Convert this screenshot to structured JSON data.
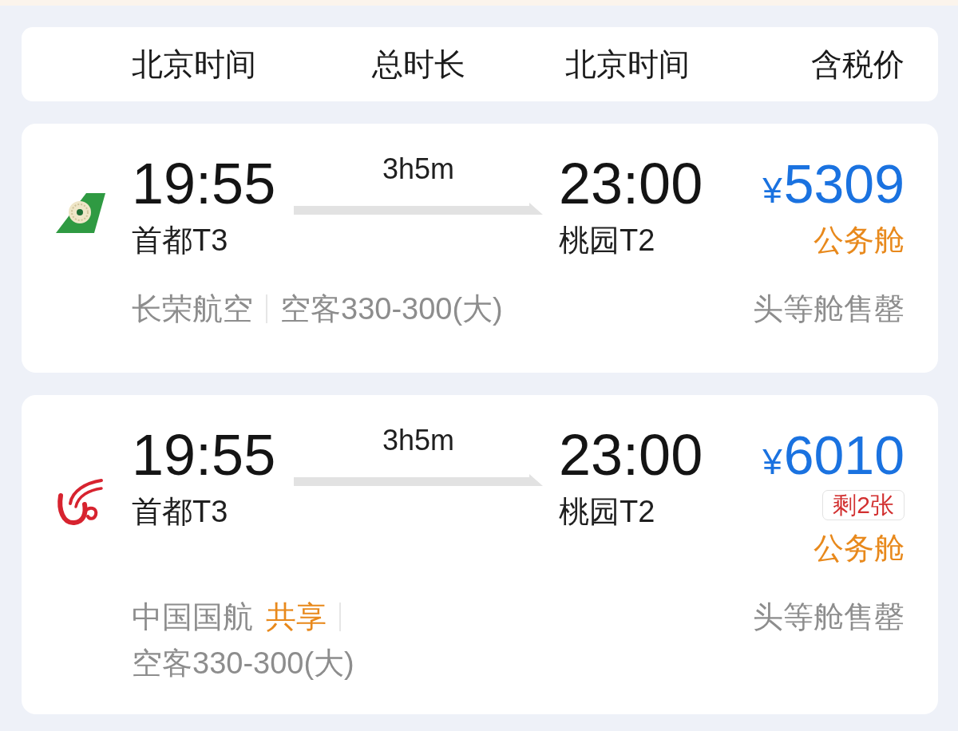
{
  "header": {
    "columns": [
      "北京时间",
      "总时长",
      "北京时间",
      "含税价"
    ]
  },
  "flights": [
    {
      "logo": {
        "kind": "tail"
      },
      "departure": {
        "time": "19:55",
        "airport": "首都T3"
      },
      "duration": "3h5m",
      "arrival": {
        "time": "23:00",
        "airport": "桃园T2"
      },
      "price": {
        "currency": "¥",
        "amount": "5309"
      },
      "cabin": "公务舱",
      "airline": "长荣航空",
      "aircraft": "空客330-300(大)",
      "note": "头等舱售罄"
    },
    {
      "logo": {
        "kind": "wings"
      },
      "departure": {
        "time": "19:55",
        "airport": "首都T3"
      },
      "duration": "3h5m",
      "arrival": {
        "time": "23:00",
        "airport": "桃园T2"
      },
      "price": {
        "currency": "¥",
        "amount": "6010"
      },
      "seats_left": "剩2张",
      "cabin": "公务舱",
      "airline": "中国国航",
      "codeshare": "共享",
      "aircraft": "空客330-300(大)",
      "note": "头等舱售罄"
    }
  ]
}
